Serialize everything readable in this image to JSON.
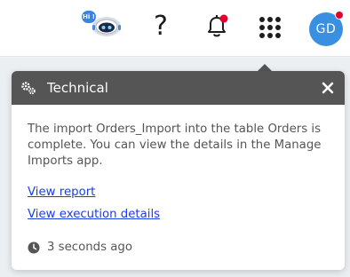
{
  "topbar": {
    "assistant_badge": "Hi !",
    "help_label": "?",
    "avatar_initials": "GD"
  },
  "notification": {
    "title": "Technical",
    "message": "The import Orders_Import into the table Orders is complete. You can view the details in the Manage Imports app.",
    "link_report": "View report",
    "link_execution": "View execution details",
    "timestamp": "3 seconds ago"
  },
  "colors": {
    "header_bg": "#555555",
    "link": "#1a3ee8",
    "avatar_bg": "#3a8fe0",
    "alert_dot": "#e4002b"
  },
  "icons": [
    "assistant-bot-icon",
    "help-icon",
    "bell-icon",
    "apps-grid-icon",
    "gears-icon",
    "close-icon",
    "clock-icon"
  ]
}
